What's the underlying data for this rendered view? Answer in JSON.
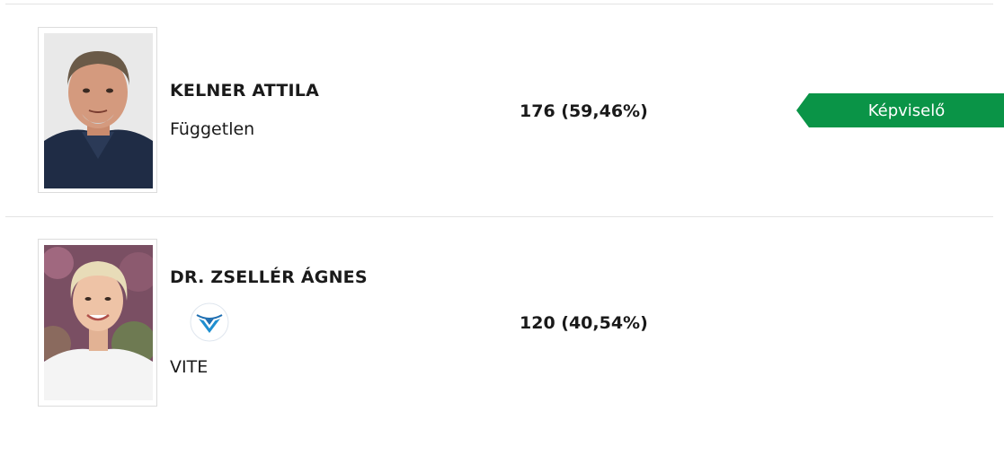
{
  "candidates": [
    {
      "name": "KELNER ATTILA",
      "party": "Független",
      "votes": "176 (59,46%)",
      "status": "Képviselő"
    },
    {
      "name": "DR. ZSELLÉR ÁGNES",
      "party": "VITE",
      "votes": "120 (40,54%)",
      "party_logo": "vite-logo-icon"
    }
  ],
  "colors": {
    "badge_green": "#0a9447",
    "divider": "#e3e3e3"
  }
}
